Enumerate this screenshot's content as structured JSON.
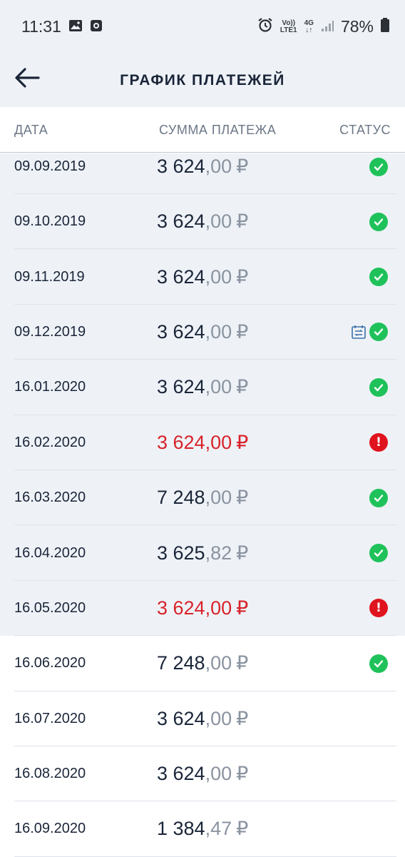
{
  "status_bar": {
    "time": "11:31",
    "volte_top": "Vo))",
    "volte_bottom": "LTE1",
    "network": "4G",
    "battery": "78%"
  },
  "app_bar": {
    "title": "ГРАФИК ПЛАТЕЖЕЙ",
    "back_icon": "arrow-left-icon"
  },
  "table": {
    "headers": {
      "date": "ДАТА",
      "amount": "СУММА ПЛАТЕЖА",
      "status": "СТАТУС"
    },
    "rows": [
      {
        "date": "09.09.2019",
        "int": "3 624",
        "dec": ",00",
        "currency": "₽",
        "status": "paid",
        "calendar": false,
        "state": "paid"
      },
      {
        "date": "09.10.2019",
        "int": "3 624",
        "dec": ",00",
        "currency": "₽",
        "status": "paid",
        "calendar": false,
        "state": "paid"
      },
      {
        "date": "09.11.2019",
        "int": "3 624",
        "dec": ",00",
        "currency": "₽",
        "status": "paid",
        "calendar": false,
        "state": "paid"
      },
      {
        "date": "09.12.2019",
        "int": "3 624",
        "dec": ",00",
        "currency": "₽",
        "status": "paid",
        "calendar": true,
        "state": "paid"
      },
      {
        "date": "16.01.2020",
        "int": "3 624",
        "dec": ",00",
        "currency": "₽",
        "status": "paid",
        "calendar": false,
        "state": "paid"
      },
      {
        "date": "16.02.2020",
        "int": "3 624",
        "dec": ",00",
        "currency": "₽",
        "status": "overdue",
        "calendar": false,
        "state": "paid"
      },
      {
        "date": "16.03.2020",
        "int": "7 248",
        "dec": ",00",
        "currency": "₽",
        "status": "paid",
        "calendar": false,
        "state": "paid"
      },
      {
        "date": "16.04.2020",
        "int": "3 625",
        "dec": ",82",
        "currency": "₽",
        "status": "paid",
        "calendar": false,
        "state": "paid"
      },
      {
        "date": "16.05.2020",
        "int": "3 624",
        "dec": ",00",
        "currency": "₽",
        "status": "overdue",
        "calendar": false,
        "state": "paid"
      },
      {
        "date": "16.06.2020",
        "int": "7 248",
        "dec": ",00",
        "currency": "₽",
        "status": "paid",
        "calendar": false,
        "state": "future"
      },
      {
        "date": "16.07.2020",
        "int": "3 624",
        "dec": ",00",
        "currency": "₽",
        "status": "none",
        "calendar": false,
        "state": "future"
      },
      {
        "date": "16.08.2020",
        "int": "3 624",
        "dec": ",00",
        "currency": "₽",
        "status": "none",
        "calendar": false,
        "state": "future"
      },
      {
        "date": "16.09.2020",
        "int": "1 384",
        "dec": ",47",
        "currency": "₽",
        "status": "none",
        "calendar": false,
        "state": "future"
      }
    ]
  },
  "colors": {
    "header_bg": "#eef2f7",
    "paid_bg": "#eef2f7",
    "ok_green": "#1fc25a",
    "error_red": "#e0141e",
    "overdue_text": "#d8232a",
    "text_dark": "#1a2538",
    "text_muted": "#8a93a0"
  }
}
